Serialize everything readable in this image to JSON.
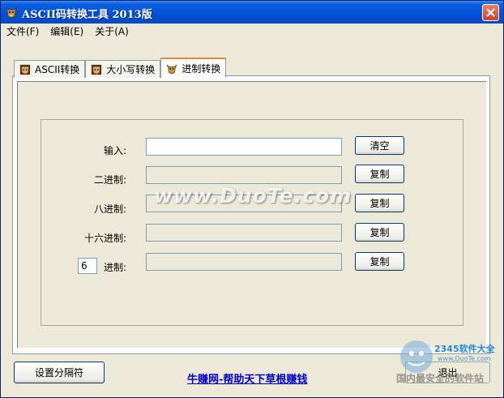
{
  "window": {
    "title": "ASCII码转换工具 2013版"
  },
  "menu": [
    "文件(F)",
    "编辑(E)",
    "关于(A)"
  ],
  "tabs": [
    {
      "label": "ASCII转换"
    },
    {
      "label": "大小写转换"
    },
    {
      "label": "进制转换",
      "active": true
    }
  ],
  "form": {
    "input_label": "输入:",
    "binary_label": "二进制:",
    "octal_label": "八进制:",
    "hex_label": "十六进制:",
    "custom_base_value": "6",
    "custom_label": "进制:",
    "clear_button": "清空",
    "copy_button": "复制"
  },
  "footer": {
    "separator_button": "设置分隔符",
    "link_text": "牛赚网-帮助天下草根赚钱",
    "exit_button": "退出"
  },
  "watermarks": {
    "main": "www.DuoTe.com",
    "logo_title": "2345软件大全",
    "logo_url": "www.DuoTe.com",
    "logo_subtitle": "国内最安全的软件站"
  },
  "colors": {
    "titlebar": "#0050d8",
    "active_tab_accent": "#e68b2c",
    "link": "#0000cc"
  }
}
